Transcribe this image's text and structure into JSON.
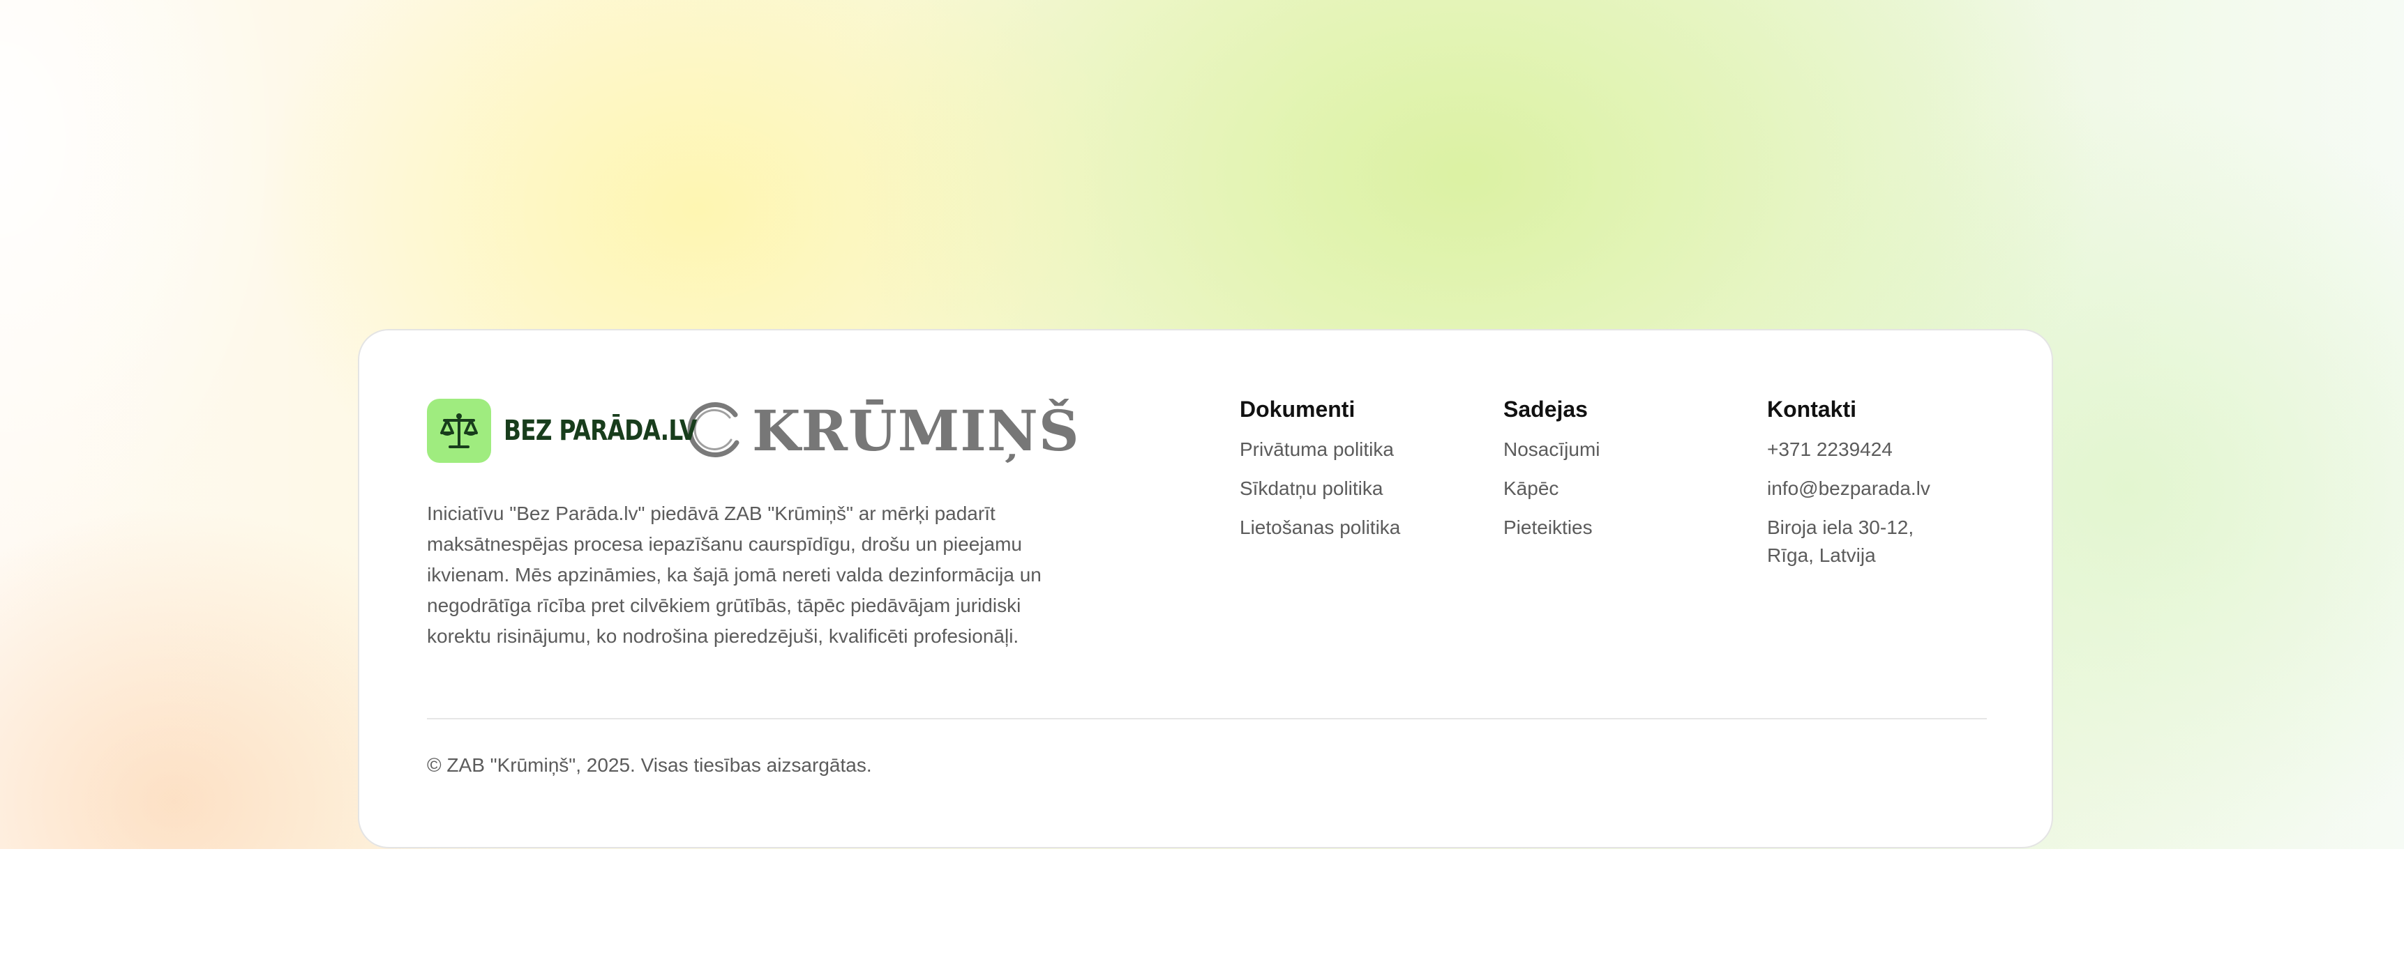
{
  "brand": {
    "logo_text": "BEZ PARĀDA.LV",
    "partner_logo_text": "KRŪMIŅŠ",
    "logo_icon": "scales-icon",
    "accent_color": "#9fec7f",
    "logo_text_color": "#183d1c"
  },
  "description": "Iniciatīvu \"Bez Parāda.lv\" piedāvā ZAB \"Krūmiņš\" ar mērķi padarīt maksātnespējas procesa iepazīšanu caurspīdīgu, drošu un pieejamu ikvienam. Mēs apzināmies, ka šajā jomā nereti valda dezinformācija un negodrātīga rīcība pret cilvēkiem grūtībās, tāpēc piedāvājam juridiski korektu risinājumu, ko nodrošina pieredzējuši, kvalificēti profesionāļi.",
  "columns": {
    "documents": {
      "title": "Dokumenti",
      "items": [
        "Privātuma politika",
        "Sīkdatņu politika",
        "Lietošanas politika"
      ]
    },
    "nav": {
      "title": "Sadejas",
      "items": [
        "Nosacījumi",
        "Kāpēc",
        "Pieteikties"
      ]
    },
    "contacts": {
      "title": "Kontakti",
      "phone": "+371 2239424",
      "email": "info@bezparada.lv",
      "address_line1": "Biroja iela 30-12,",
      "address_line2": "Rīga, Latvija"
    }
  },
  "copyright": "© ZAB \"Krūmiņš\", 2025. Visas tiesības aizsargātas."
}
